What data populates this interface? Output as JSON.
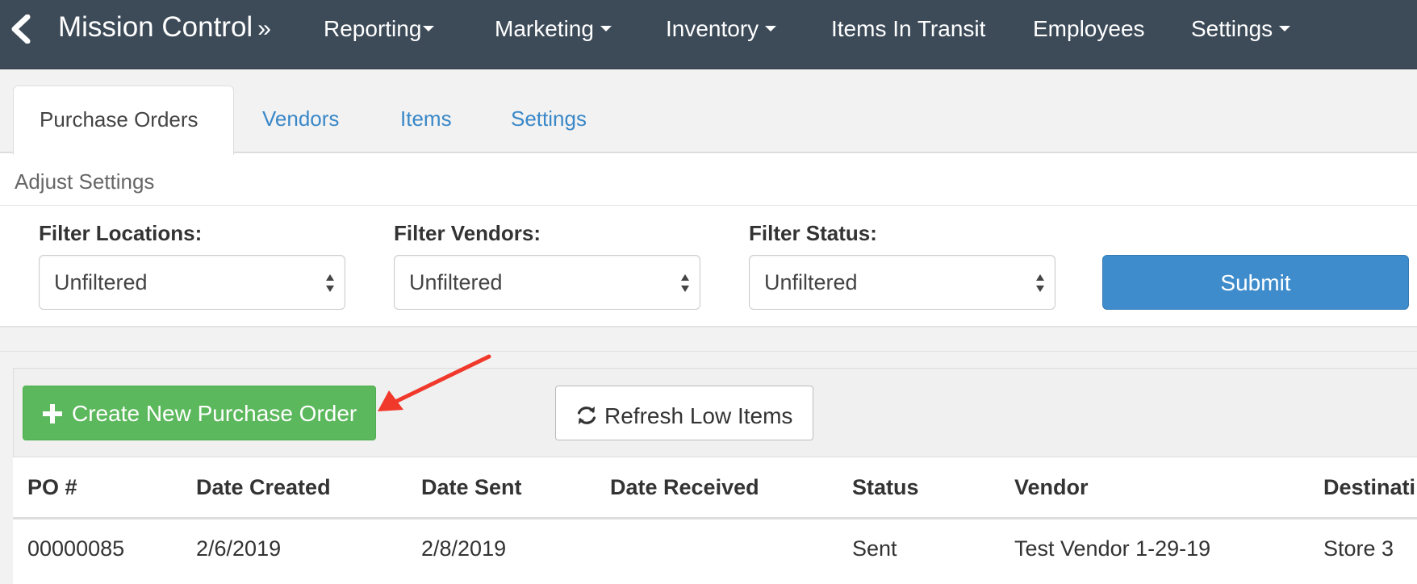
{
  "navbar": {
    "brand": "Mission Control",
    "brand_suffix": "»",
    "items": [
      {
        "label": "Reporting",
        "dropdown": true
      },
      {
        "label": "Marketing",
        "dropdown": true
      },
      {
        "label": "Inventory",
        "dropdown": true
      },
      {
        "label": "Items In Transit",
        "dropdown": false
      },
      {
        "label": "Employees",
        "dropdown": false
      },
      {
        "label": "Settings",
        "dropdown": true
      }
    ]
  },
  "tabs": [
    {
      "label": "Purchase Orders",
      "active": true
    },
    {
      "label": "Vendors",
      "active": false
    },
    {
      "label": "Items",
      "active": false
    },
    {
      "label": "Settings",
      "active": false
    }
  ],
  "settings_panel": {
    "title": "Adjust Settings",
    "filters": [
      {
        "label": "Filter Locations:",
        "value": "Unfiltered"
      },
      {
        "label": "Filter Vendors:",
        "value": "Unfiltered"
      },
      {
        "label": "Filter Status:",
        "value": "Unfiltered"
      }
    ],
    "submit_label": "Submit"
  },
  "actions": {
    "create_label": "Create New Purchase Order",
    "refresh_label": "Refresh Low Items"
  },
  "table": {
    "columns": [
      "PO #",
      "Date Created",
      "Date Sent",
      "Date Received",
      "Status",
      "Vendor",
      "Destinati"
    ],
    "rows": [
      [
        "00000085",
        "2/6/2019",
        "2/8/2019",
        "",
        "Sent",
        "Test Vendor 1-29-19",
        "Store 3"
      ]
    ]
  },
  "colors": {
    "navbar": "#3d4b59",
    "link": "#3a88c8",
    "primary": "#3e8ccc",
    "success": "#5cb85c",
    "annotation_arrow": "#f0392b"
  }
}
